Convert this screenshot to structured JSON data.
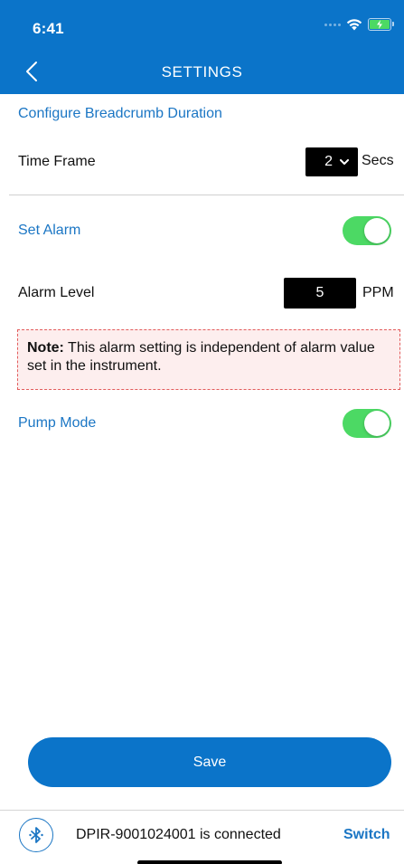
{
  "status_bar": {
    "time": "6:41",
    "icons": [
      "signal-icon",
      "wifi-icon",
      "battery-charging-icon"
    ]
  },
  "nav": {
    "title": "SETTINGS",
    "back_icon": "chevron-left-icon"
  },
  "breadcrumb_section": {
    "title": "Configure Breadcrumb Duration",
    "time_frame_label": "Time Frame",
    "time_frame_value": "2",
    "time_frame_unit": "Secs"
  },
  "alarm": {
    "set_alarm_label": "Set Alarm",
    "set_alarm_enabled": true,
    "level_label": "Alarm Level",
    "level_value": "5",
    "level_unit": "PPM",
    "note_bold": "Note:",
    "note_text": " This alarm setting is independent of alarm value set in the instrument."
  },
  "pump": {
    "label": "Pump Mode",
    "enabled": true
  },
  "actions": {
    "save_label": "Save"
  },
  "connection": {
    "icon": "bluetooth-icon",
    "text": "DPIR-9001024001  is connected",
    "switch_label": "Switch"
  },
  "colors": {
    "primary": "#0b74c9",
    "toggle_on": "#4cd964",
    "note_border": "#e25c5c",
    "note_bg": "#fdeeee"
  }
}
